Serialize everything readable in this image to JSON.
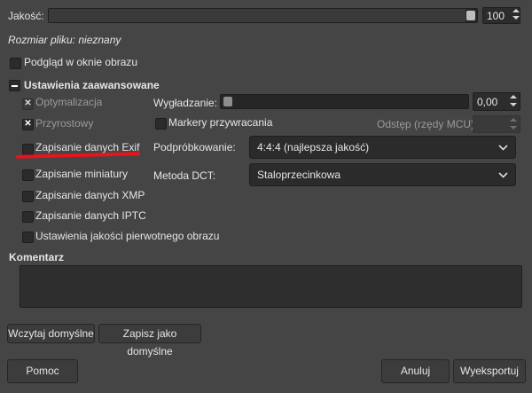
{
  "quality": {
    "label": "Jakość:",
    "value": "100",
    "level": 1.0
  },
  "file_size_text": "Rozmiar pliku: nieznany",
  "preview": {
    "label": "Podgląd w oknie obrazu",
    "checked": false
  },
  "advanced": {
    "header": "Ustawienia zaawansowane",
    "optimization": {
      "label": "Optymalizacja",
      "checked": true
    },
    "progressive": {
      "label": "Przyrostowy",
      "checked": true
    },
    "save_exif": {
      "label": "Zapisanie danych Exif",
      "checked": false
    },
    "save_thumbnail": {
      "label": "Zapisanie miniatury",
      "checked": false
    },
    "save_xmp": {
      "label": "Zapisanie danych XMP",
      "checked": false
    },
    "save_iptc": {
      "label": "Zapisanie danych IPTC",
      "checked": false
    },
    "original_quality": {
      "label": "Ustawienia jakości pierwotnego obrazu",
      "checked": false
    },
    "smoothing": {
      "label": "Wygładzanie:",
      "value": "0,00",
      "level": 0.0
    },
    "restart_markers": {
      "label": "Markery przywracania",
      "checked": false
    },
    "interval": {
      "label": "Odstęp (rzędy MCU):",
      "value": ""
    },
    "subsampling": {
      "label": "Podpróbkowanie:",
      "value": "4:4:4 (najlepsza jakość)"
    },
    "dct": {
      "label": "Metoda DCT:",
      "value": "Staloprzecinkowa"
    }
  },
  "comment": {
    "label": "Komentarz",
    "value": ""
  },
  "buttons": {
    "load_defaults": "Wczytaj domyślne",
    "save_defaults": "Zapisz jako domyślne",
    "help": "Pomoc",
    "cancel": "Anuluj",
    "export": "Wyeksportuj"
  },
  "colors": {
    "annotation_underline": "#e8141c",
    "background": "#454545"
  }
}
